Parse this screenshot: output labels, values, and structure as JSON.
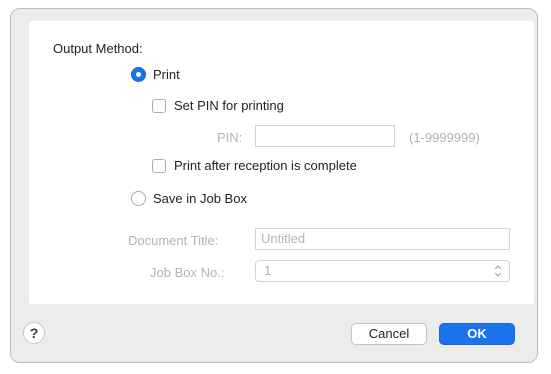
{
  "output_method": {
    "heading": "Output Method:",
    "print": {
      "label": "Print",
      "selected": true
    },
    "set_pin": {
      "label": "Set PIN for printing",
      "checked": false,
      "pin_label": "PIN:",
      "pin_value": "",
      "pin_range": "(1-9999999)"
    },
    "print_after_reception": {
      "label": "Print after reception is complete",
      "checked": false
    },
    "save_in_job_box": {
      "label": "Save in Job Box",
      "selected": false
    },
    "document_title": {
      "label": "Document Title:",
      "placeholder": "Untitled"
    },
    "job_box_no": {
      "label": "Job Box No.:",
      "value": "1"
    }
  },
  "footer": {
    "help_label": "?",
    "cancel_label": "Cancel",
    "ok_label": "OK"
  },
  "colors": {
    "accent": "#1b73ea",
    "dialog_bg": "#ececec",
    "disabled_text": "#b3b3b3"
  }
}
